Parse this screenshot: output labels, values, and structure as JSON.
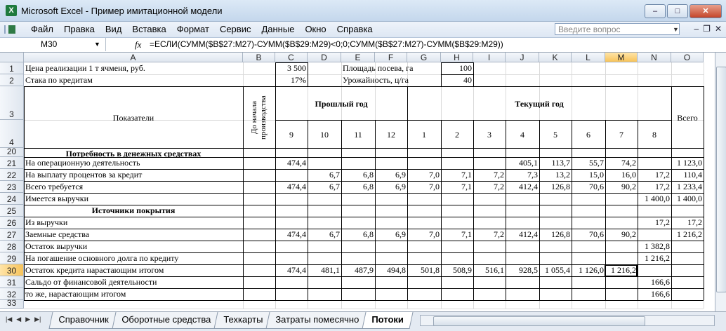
{
  "window": {
    "title": "Microsoft Excel - Пример имитационной модели",
    "minimize": "–",
    "maximize": "□",
    "close": "✕"
  },
  "menu": {
    "items": [
      "Файл",
      "Правка",
      "Вид",
      "Вставка",
      "Формат",
      "Сервис",
      "Данные",
      "Окно",
      "Справка"
    ],
    "help_placeholder": "Введите вопрос",
    "mdi": [
      "–",
      "❐",
      "✕"
    ]
  },
  "formula_bar": {
    "name_box": "M30",
    "fx": "fx",
    "formula": "=ЕСЛИ(СУММ($B$27:M27)-СУММ($B$29:M29)<0;0;СУММ($B$27:M27)-СУММ($B$29:M29))"
  },
  "columns": [
    "A",
    "B",
    "C",
    "D",
    "E",
    "F",
    "G",
    "H",
    "I",
    "J",
    "K",
    "L",
    "M",
    "N",
    "O"
  ],
  "selected_column": "M",
  "selected_row": "30",
  "rows": [
    "1",
    "2",
    "3",
    "4",
    "20",
    "21",
    "22",
    "23",
    "24",
    "25",
    "26",
    "27",
    "28",
    "29",
    "30",
    "31",
    "32",
    "33"
  ],
  "top": {
    "r1_label": "Цена реализации 1 т ячменя, руб.",
    "r1_value": "3 500",
    "r1_label2": "Площадь посева, га",
    "r1_value2": "100",
    "r2_label": "Стака по кредитам",
    "r2_value": "17%",
    "r2_label2": "Урожайность, ц/га",
    "r2_value2": "40"
  },
  "header": {
    "indicators": "Показатели",
    "before_start": "До начала производства",
    "last_year": "Прошлый год",
    "current_year": "Текущий год",
    "total": "Всего",
    "months": [
      "9",
      "10",
      "11",
      "12",
      "1",
      "2",
      "3",
      "4",
      "5",
      "6",
      "7",
      "8"
    ]
  },
  "body": [
    {
      "row": "20",
      "label": "Потребность в денежных средствах",
      "section": true,
      "values": [
        "",
        "",
        "",
        "",
        "",
        "",
        "",
        "",
        "",
        "",
        "",
        "",
        "",
        ""
      ]
    },
    {
      "row": "21",
      "label": "На операционную деятельность",
      "values": [
        "",
        "474,4",
        "",
        "",
        "",
        "",
        "",
        "",
        "405,1",
        "113,7",
        "55,7",
        "74,2",
        "",
        "1 123,0"
      ]
    },
    {
      "row": "22",
      "label": "На выплату процентов за кредит",
      "values": [
        "",
        "",
        "6,7",
        "6,8",
        "6,9",
        "7,0",
        "7,1",
        "7,2",
        "7,3",
        "13,2",
        "15,0",
        "16,0",
        "17,2",
        "110,4"
      ]
    },
    {
      "row": "23",
      "label": "Всего требуется",
      "values": [
        "",
        "474,4",
        "6,7",
        "6,8",
        "6,9",
        "7,0",
        "7,1",
        "7,2",
        "412,4",
        "126,8",
        "70,6",
        "90,2",
        "17,2",
        "1 233,4"
      ]
    },
    {
      "row": "24",
      "label": "Имеется выручки",
      "values": [
        "",
        "",
        "",
        "",
        "",
        "",
        "",
        "",
        "",
        "",
        "",
        "",
        "1 400,0",
        "1 400,0"
      ]
    },
    {
      "row": "25",
      "label": "Источники покрытия",
      "section": true,
      "values": [
        "",
        "",
        "",
        "",
        "",
        "",
        "",
        "",
        "",
        "",
        "",
        "",
        "",
        ""
      ]
    },
    {
      "row": "26",
      "label": "Из выручки",
      "values": [
        "",
        "",
        "",
        "",
        "",
        "",
        "",
        "",
        "",
        "",
        "",
        "",
        "17,2",
        "17,2"
      ]
    },
    {
      "row": "27",
      "label": "Заемные средства",
      "values": [
        "",
        "474,4",
        "6,7",
        "6,8",
        "6,9",
        "7,0",
        "7,1",
        "7,2",
        "412,4",
        "126,8",
        "70,6",
        "90,2",
        "",
        "1 216,2"
      ]
    },
    {
      "row": "28",
      "label": "Остаток выручки",
      "values": [
        "",
        "",
        "",
        "",
        "",
        "",
        "",
        "",
        "",
        "",
        "",
        "",
        "1 382,8",
        ""
      ]
    },
    {
      "row": "29",
      "label": "На погашение основного долга по кредиту",
      "values": [
        "",
        "",
        "",
        "",
        "",
        "",
        "",
        "",
        "",
        "",
        "",
        "",
        "1 216,2",
        ""
      ]
    },
    {
      "row": "30",
      "label": "Остаток кредита нарастающим итогом",
      "values": [
        "",
        "474,4",
        "481,1",
        "487,9",
        "494,8",
        "501,8",
        "508,9",
        "516,1",
        "928,5",
        "1 055,4",
        "1 126,0",
        "1 216,2",
        "",
        ""
      ]
    },
    {
      "row": "31",
      "label": "Сальдо от финансовой деятельности",
      "values": [
        "",
        "",
        "",
        "",
        "",
        "",
        "",
        "",
        "",
        "",
        "",
        "",
        "166,6",
        ""
      ]
    },
    {
      "row": "32",
      "label": "то же, нарастающим итогом",
      "values": [
        "",
        "",
        "",
        "",
        "",
        "",
        "",
        "",
        "",
        "",
        "",
        "",
        "166,6",
        ""
      ]
    }
  ],
  "sheet_tabs": [
    "Справочник",
    "Оборотные средства",
    "Техкарты",
    "Затраты помесячно",
    "Потоки"
  ],
  "active_tab": "Потоки"
}
